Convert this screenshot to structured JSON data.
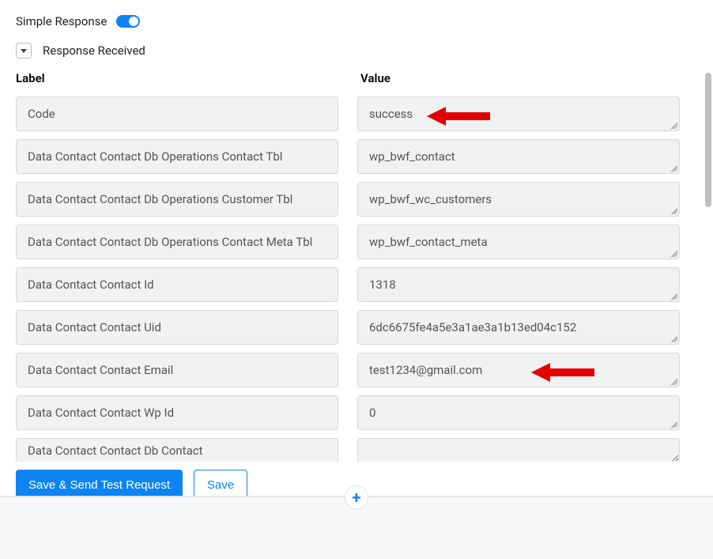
{
  "header": {
    "simple_response_label": "Simple Response",
    "toggle_on": true,
    "response_received_label": "Response Received"
  },
  "columns": {
    "label": "Label",
    "value": "Value"
  },
  "rows": [
    {
      "label": "Code",
      "value": "success"
    },
    {
      "label": "Data Contact Contact Db Operations Contact Tbl",
      "value": "wp_bwf_contact"
    },
    {
      "label": "Data Contact Contact Db Operations Customer Tbl",
      "value": "wp_bwf_wc_customers"
    },
    {
      "label": "Data Contact Contact Db Operations Contact Meta Tbl",
      "value": "wp_bwf_contact_meta"
    },
    {
      "label": "Data Contact Contact Id",
      "value": "1318"
    },
    {
      "label": "Data Contact Contact Uid",
      "value": "6dc6675fe4a5e3a1ae3a1b13ed04c152"
    },
    {
      "label": "Data Contact Contact Email",
      "value": "test1234@gmail.com"
    },
    {
      "label": "Data Contact Contact Wp Id",
      "value": "0"
    },
    {
      "label": "Data Contact Contact Db Contact",
      "value": ""
    }
  ],
  "actions": {
    "save_send": "Save & Send Test Request",
    "save": "Save"
  },
  "annotation": {
    "arrow_color": "#e30000"
  }
}
